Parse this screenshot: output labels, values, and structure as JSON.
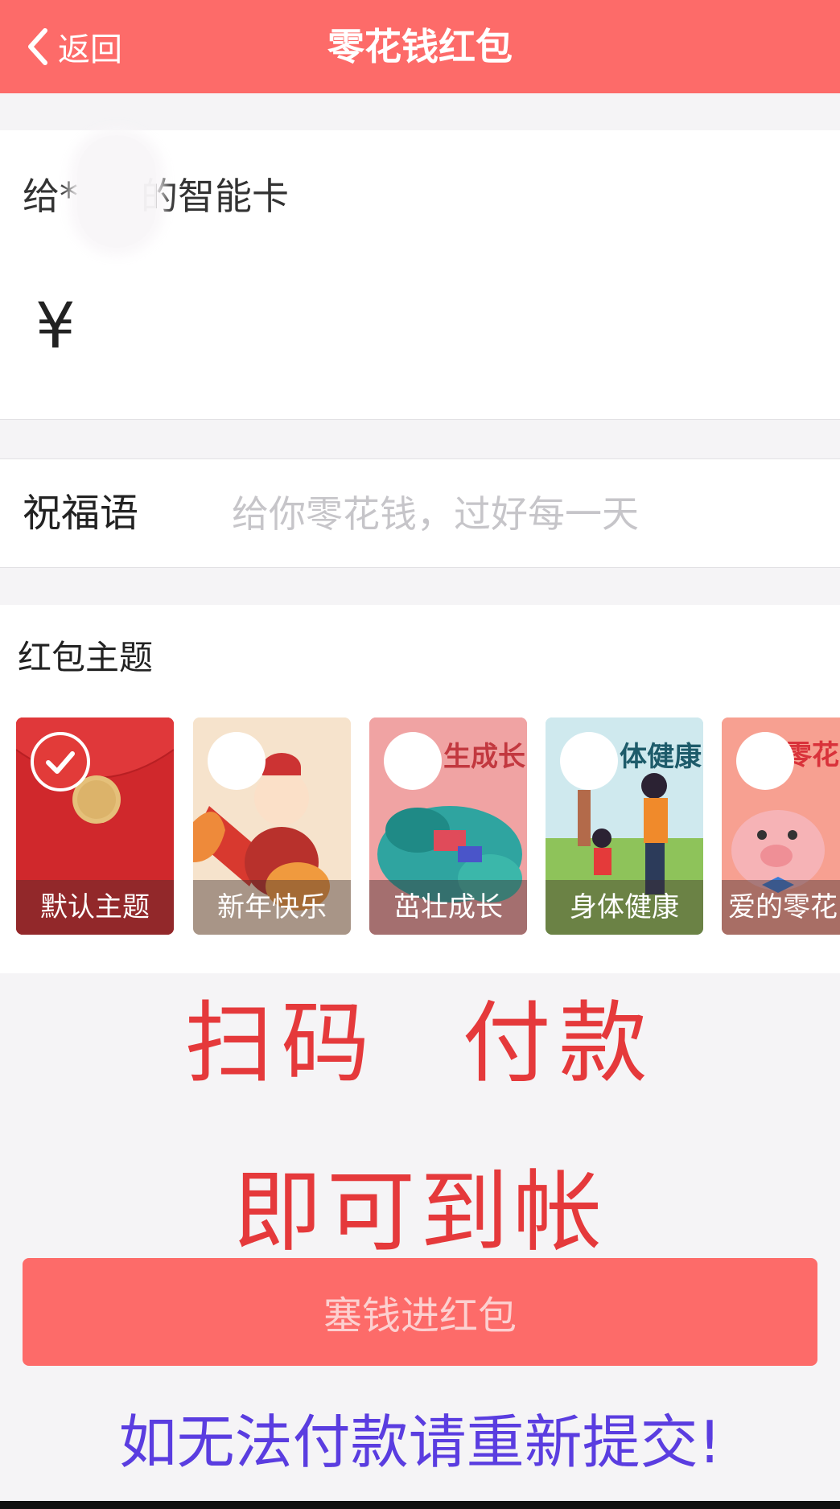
{
  "header": {
    "back_label": "返回",
    "title": "零花钱红包"
  },
  "card": {
    "recipient_prefix": "给*",
    "recipient_suffix": "的智能卡",
    "currency": "¥"
  },
  "blessing": {
    "label": "祝福语",
    "placeholder": "给你零花钱，过好每一天"
  },
  "themes": {
    "title": "红包主题",
    "items": [
      {
        "label": "默认主题",
        "selected": true
      },
      {
        "label": "新年快乐",
        "selected": false
      },
      {
        "label": "茁壮成长",
        "selected": false
      },
      {
        "label": "身体健康",
        "selected": false
      },
      {
        "label": "爱的零花",
        "selected": false
      }
    ]
  },
  "overlay": {
    "line1": "扫码 付款",
    "line2": "即可到帐"
  },
  "submit_label": "塞钱进红包",
  "notice": "如无法付款请重新提交!",
  "colors": {
    "brand": "#fd6b69",
    "overlay_text": "#e5393b",
    "notice_text": "#5a3de0"
  }
}
